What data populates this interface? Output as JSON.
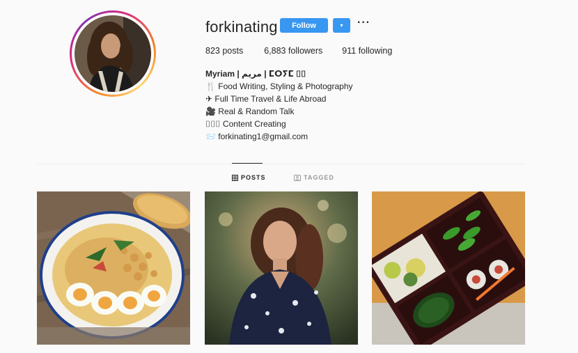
{
  "profile": {
    "username": "forkinating",
    "follow_label": "Follow",
    "dropdown_glyph": "▾",
    "more_glyph": "···"
  },
  "stats": {
    "posts": "823 posts",
    "followers": "6,883 followers",
    "following": "911 following"
  },
  "bio": {
    "name": "Myriam | مريم | ⵎⵔⵢⵎ ⌷⌷",
    "lines": [
      "🍴 Food Writing, Styling & Photography",
      "✈ Full Time Travel & Life Abroad",
      "🎥 Real & Random Talk",
      "⌷⌷⌷ Content Creating",
      "📨 forkinating1@gmail.com"
    ]
  },
  "tabs": {
    "posts": "POSTS",
    "tagged": "TAGGED"
  },
  "colors": {
    "accent": "#3897f0",
    "text": "#262626",
    "muted": "#999999",
    "background": "#fafafa"
  },
  "icons": {
    "grid": "grid-icon",
    "tagged": "tagged-icon",
    "dropdown": "chevron-down-icon",
    "more": "more-options-icon"
  }
}
